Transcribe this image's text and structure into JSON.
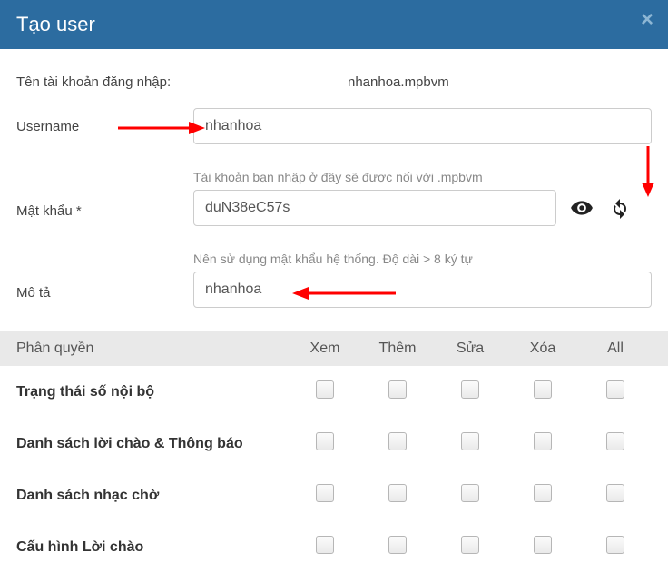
{
  "header": {
    "title": "Tạo user",
    "close_glyph": "×"
  },
  "form": {
    "account_name_label": "Tên tài khoản đăng nhập:",
    "account_name_value": "nhanhoa.mpbvm",
    "username_label": "Username",
    "username_value": "nhanhoa",
    "username_helper": "Tài khoản bạn nhập ở đây sẽ được nối với .mpbvm",
    "password_label": "Mật khẩu *",
    "password_value": "duN38eC57s",
    "password_helper": "Nên sử dụng mật khẩu hệ thống. Độ dài > 8 ký tự",
    "description_label": "Mô tả",
    "description_value": "nhanhoa"
  },
  "permissions": {
    "section_label": "Phân quyền",
    "columns": [
      "Xem",
      "Thêm",
      "Sửa",
      "Xóa",
      "All"
    ],
    "rows": [
      "Trạng thái số nội bộ",
      "Danh sách lời chào & Thông báo",
      "Danh sách nhạc chờ",
      "Cấu hình Lời chào"
    ]
  }
}
